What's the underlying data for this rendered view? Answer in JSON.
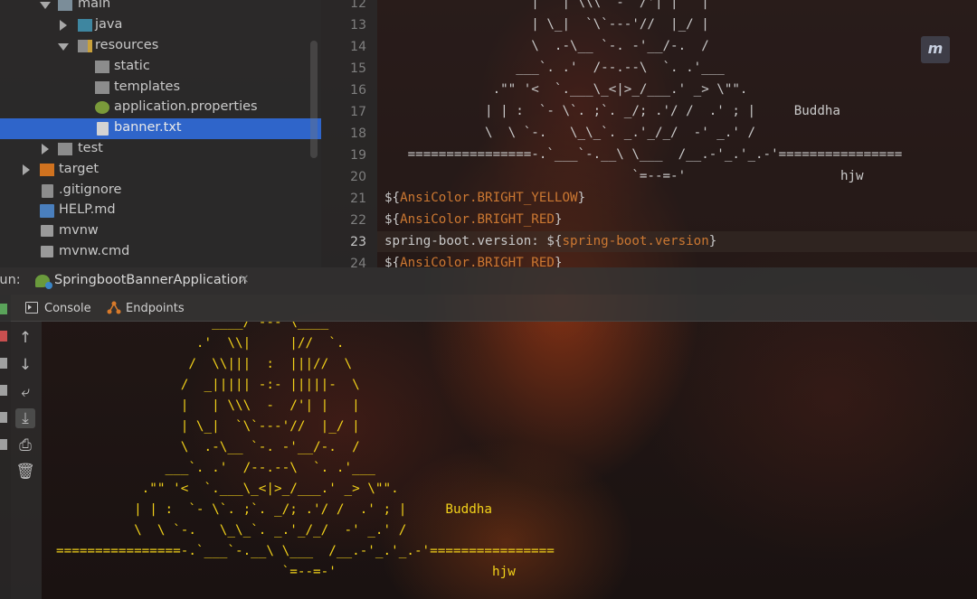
{
  "project_tree": {
    "items": [
      {
        "label": "main",
        "icon": "folder-icon",
        "expanded": true
      },
      {
        "label": "java",
        "icon": "source-folder-icon",
        "expanded": false
      },
      {
        "label": "resources",
        "icon": "resources-folder-icon",
        "expanded": true
      },
      {
        "label": "static",
        "icon": "folder-icon"
      },
      {
        "label": "templates",
        "icon": "folder-icon"
      },
      {
        "label": "application.properties",
        "icon": "spring-properties-icon"
      },
      {
        "label": "banner.txt",
        "icon": "text-file-icon",
        "selected": true
      },
      {
        "label": "test",
        "icon": "folder-icon",
        "expanded": false
      },
      {
        "label": "target",
        "icon": "excluded-folder-icon",
        "expanded": false
      },
      {
        "label": ".gitignore",
        "icon": "gitignore-file-icon"
      },
      {
        "label": "HELP.md",
        "icon": "markdown-file-icon"
      },
      {
        "label": "mvnw",
        "icon": "shell-file-icon"
      },
      {
        "label": "mvnw.cmd",
        "icon": "cmd-file-icon"
      }
    ]
  },
  "editor": {
    "line_numbers": [
      "12",
      "13",
      "14",
      "15",
      "16",
      "17",
      "18",
      "19",
      "20",
      "21",
      "22",
      "23",
      "24"
    ],
    "current_line": "23",
    "lines": [
      {
        "text": "                   |   | \\\\\\  -  /'| |   |"
      },
      {
        "text": "                   | \\_|  `\\`---'//  |_/ |"
      },
      {
        "text": "                   \\  .-\\__ `-. -'__/-.  /"
      },
      {
        "text": "                 ___`. .'  /--.--\\  `. .'___"
      },
      {
        "text": "              .\"\" '<  `.___\\_<|>_/___.' _> \\\"\"."
      },
      {
        "text": "             | | :  `- \\`. ;`. _/; .'/ /  .' ; |     Buddha"
      },
      {
        "text": "             \\  \\ `-.   \\_\\_`. _.'_/_/  -' _.' /"
      },
      {
        "text": "   ================-.`___`-.__\\ \\___  /__.-'_.'_.-'================"
      },
      {
        "text": "                                `=--=-'                    hjw"
      },
      {
        "pre": "${",
        "arg": "AnsiColor.BRIGHT_YELLOW",
        "post": "}"
      },
      {
        "pre": "${",
        "arg": "AnsiColor.BRIGHT_RED",
        "post": "}"
      },
      {
        "pre": "spring-boot.version: ${",
        "arg": "spring-boot.version",
        "post": "}"
      },
      {
        "pre": "${",
        "arg": "AnsiColor.BRIGHT_RED",
        "post": "}"
      }
    ]
  },
  "run_panel": {
    "label": "Run:",
    "config_tab": "SpringbootBannerApplication",
    "close_glyph": "×",
    "subtabs": [
      {
        "label": "Console",
        "icon": "console-icon"
      },
      {
        "label": "Endpoints",
        "icon": "endpoints-icon"
      }
    ],
    "toolbar_icons": [
      "arrow-up-icon",
      "arrow-down-icon",
      "soft-wrap-icon",
      "scroll-to-end-icon",
      "print-icon",
      "trash-icon"
    ]
  },
  "console_output": [
    "                    ____/`---'\\____",
    "                  .'  \\\\|     |//  `.",
    "                 /  \\\\|||  :  |||//  \\",
    "                /  _||||| -:- |||||-  \\",
    "                |   | \\\\\\  -  /'| |   |",
    "                | \\_|  `\\`---'//  |_/ |",
    "                \\  .-\\__ `-. -'__/-.  /",
    "              ___`. .'  /--.--\\  `. .'___",
    "           .\"\" '<  `.___\\_<|>_/___.' _> \\\"\".",
    "          | | :  `- \\`. ;`. _/; .'/ /  .' ; |     Buddha",
    "          \\  \\ `-.   \\_\\_`. _.'_/_/  -' _.' /",
    "================-.`___`-.__\\ \\___  /__.-'_.'_.-'================",
    "                             `=--=-'                    hjw"
  ],
  "colors": {
    "console_text": "#f2d11a",
    "selection": "#2f65ca",
    "ansi_arg": "#cc7832"
  }
}
